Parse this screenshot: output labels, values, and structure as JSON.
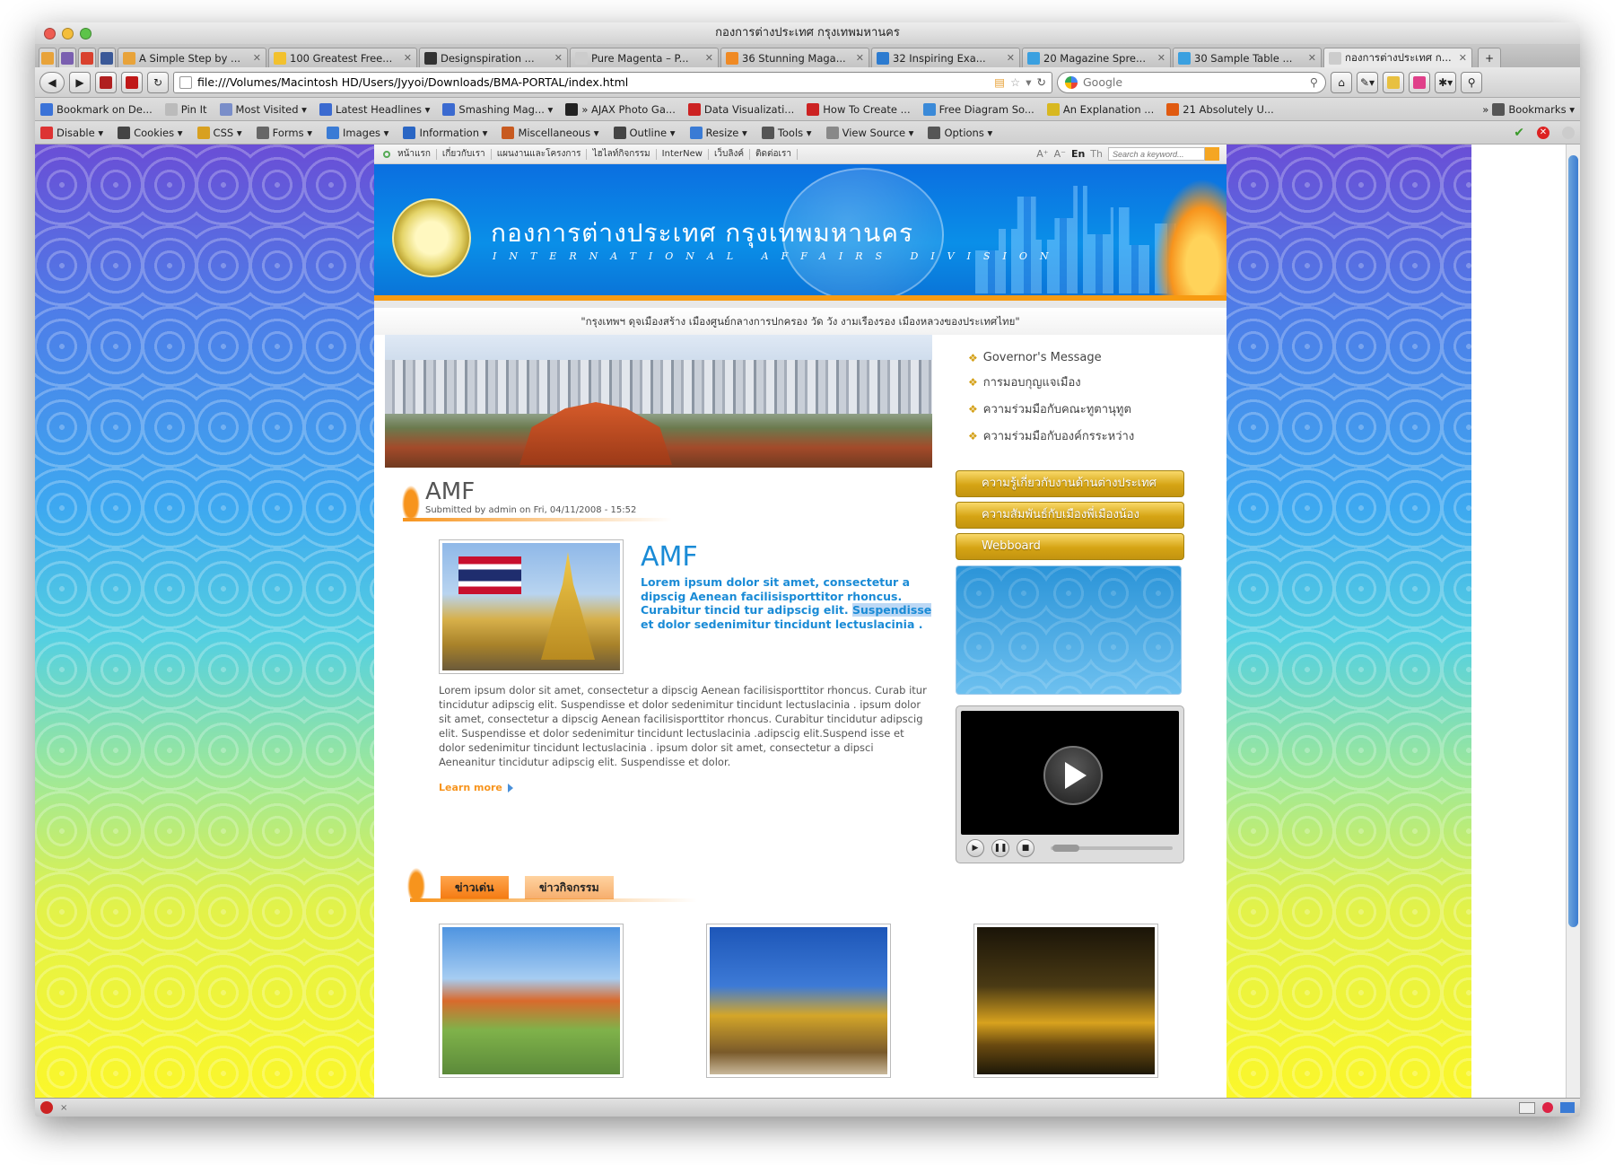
{
  "window": {
    "title": "กองการต่างประเทศ กรุงเทพมหานคร"
  },
  "tabs": [
    {
      "label": "A Simple Step by ...",
      "color": "#e8a33a"
    },
    {
      "label": "100 Greatest Free...",
      "color": "#f2c12e"
    },
    {
      "label": "Designspiration ...",
      "color": "#333333"
    },
    {
      "label": "Pure Magenta – P...",
      "color": "#cccccc"
    },
    {
      "label": "36 Stunning Maga...",
      "color": "#f08a24"
    },
    {
      "label": "32 Inspiring Exa...",
      "color": "#2c7bd0"
    },
    {
      "label": "20 Magazine Spre...",
      "color": "#3aa0e0"
    },
    {
      "label": "30 Sample Table ...",
      "color": "#3aa0e0"
    },
    {
      "label": "กองการต่างประเทศ ก...",
      "color": "#cccccc",
      "active": true
    }
  ],
  "nav": {
    "url": "file:///Volumes/Macintosh HD/Users/Jyyoi/Downloads/BMA-PORTAL/index.html",
    "search_placeholder": "Google"
  },
  "bookmarks": [
    {
      "label": "Bookmark on De...",
      "icon": "delicious-icon",
      "color": "#3b73d8"
    },
    {
      "label": "Pin It",
      "icon": "page-icon",
      "color": "#bbbbbb"
    },
    {
      "label": "Most Visited ▾",
      "icon": "history-icon",
      "color": "#7a8ec9"
    },
    {
      "label": "Latest Headlines ▾",
      "icon": "rss-icon",
      "color": "#3b6ad0"
    },
    {
      "label": "Smashing Mag... ▾",
      "icon": "rss-icon",
      "color": "#3b6ad0"
    },
    {
      "label": "» AJAX Photo Ga...",
      "icon": "w-icon",
      "color": "#222222"
    },
    {
      "label": "Data Visualizati...",
      "icon": "s-icon",
      "color": "#cc2222"
    },
    {
      "label": "How To Create ...",
      "icon": "s-icon",
      "color": "#cc2222"
    },
    {
      "label": "Free Diagram So...",
      "icon": "diagram-icon",
      "color": "#3b8ad8"
    },
    {
      "label": "An Explanation ...",
      "icon": "bookmark-icon",
      "color": "#d8b820"
    },
    {
      "label": "21 Absolutely U...",
      "icon": "s-icon",
      "color": "#e05a10"
    }
  ],
  "bookmarks_menu": "Bookmarks ▾",
  "devbar": [
    "Disable ▾",
    "Cookies ▾",
    "CSS ▾",
    "Forms ▾",
    "Images ▾",
    "Information ▾",
    "Miscellaneous ▾",
    "Outline ▾",
    "Resize ▾",
    "Tools ▾",
    "View Source ▾",
    "Options ▾"
  ],
  "site": {
    "topmenu": [
      "หน้าแรก",
      "เกี่ยวกับเรา",
      "แผนงานและโครงการ",
      "ไฮไลท์กิจกรรม",
      "InterNew",
      "เว็บลิงค์",
      "ติดต่อเรา"
    ],
    "font_controls": [
      "A⁺",
      "A⁻"
    ],
    "lang": [
      "En",
      "Th"
    ],
    "keyword_placeholder": "Search a keyword...",
    "header_thai": "กองการต่างประเทศ กรุงเทพมหานคร",
    "header_en": "INTERNATIONAL AFFAIRS DIVISION",
    "slogan": "\"กรุงเทพฯ ดุจเมืองสร้าง เมืองศูนย์กลางการปกครอง วัด วัง งามเรืองรอง เมืองหลวงของประเทศไทย\"",
    "article": {
      "title": "AMF",
      "meta": "Submitted by admin on Fri, 04/11/2008 - 15:52",
      "feature_title": "AMF",
      "lead_before": "Lorem ipsum dolor sit amet, consectetur a dipscig Aenean facilisisporttitor rhoncus. Curabitur tincid tur adipscig elit. ",
      "lead_highlight": "Suspendisse",
      "lead_after": " et dolor sedenimitur tincidunt lectuslacinia .",
      "body": "Lorem ipsum dolor sit amet, consectetur a dipscig Aenean facilisisporttitor rhoncus. Curab itur tincidutur adipscig elit. Suspendisse et dolor sedenimitur tincidunt lectuslacinia . ipsum dolor sit amet, consectetur a dipscig Aenean facilisisporttitor rhoncus. Curabitur tincidutur adipscig elit. Suspendisse et dolor sedenimitur tincidunt lectuslacinia .adipscig elit.Suspend isse et dolor sedenimitur tincidunt lectuslacinia . ipsum dolor sit amet, consectetur a dipsci Aeneanitur tincidutur adipscig elit. Suspendisse et dolor.",
      "learn_more": "Learn more"
    },
    "side_links": [
      "Governor's Message",
      "การมอบกุญแจเมือง",
      "ความร่วมมือกับคณะทูตานุทูต",
      "ความร่วมมือกับองค์กรระหว่าง"
    ],
    "gold_buttons": [
      "ความรู้เกี่ยวกับงานด้านต่างประเทศ",
      "ความสัมพันธ์กับเมืองพี่เมืองน้อง",
      "Webboard"
    ],
    "news_tabs": [
      "ข่าวเด่น",
      "ข่าวกิจกรรม"
    ]
  }
}
